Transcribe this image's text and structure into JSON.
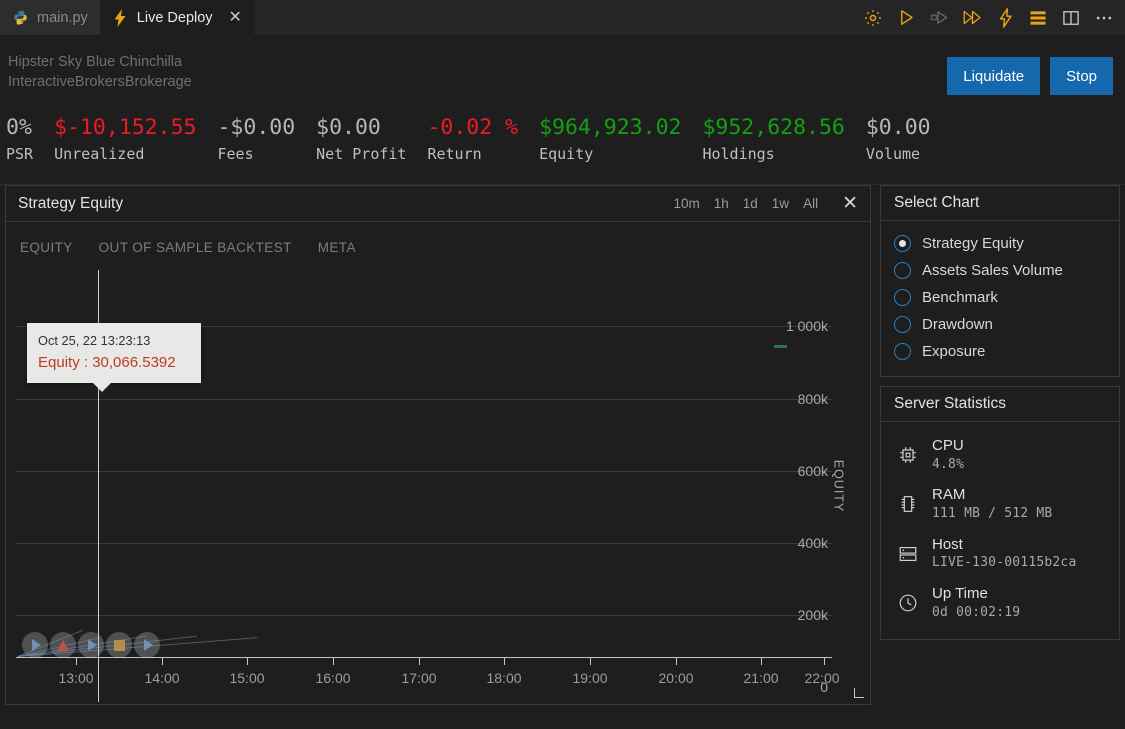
{
  "tabs": [
    {
      "label": "main.py",
      "icon": "python-icon",
      "active": false,
      "closable": false
    },
    {
      "label": "Live Deploy",
      "icon": "lightning-icon",
      "active": true,
      "closable": true,
      "close_glyph": "✕"
    }
  ],
  "toolbar_icons": [
    {
      "name": "gear-icon"
    },
    {
      "name": "play-icon"
    },
    {
      "name": "debug-play-icon"
    },
    {
      "name": "fast-forward-icon"
    },
    {
      "name": "lightning-icon"
    },
    {
      "name": "list-lines-icon"
    },
    {
      "name": "split-panel-icon"
    },
    {
      "name": "more-ellipsis-icon"
    }
  ],
  "header": {
    "project_name": "Hipster Sky Blue Chinchilla",
    "brokerage": "InteractiveBrokersBrokerage",
    "liquidate_label": "Liquidate",
    "stop_label": "Stop",
    "button_color": "#1668ad"
  },
  "stats": [
    {
      "value": "0%",
      "label": "PSR",
      "color": "grey"
    },
    {
      "value": "$-10,152.55",
      "label": "Unrealized",
      "color": "red"
    },
    {
      "value": "-$0.00",
      "label": "Fees",
      "color": "grey"
    },
    {
      "value": "$0.00",
      "label": "Net Profit",
      "color": "grey"
    },
    {
      "value": "-0.02 %",
      "label": "Return",
      "color": "red"
    },
    {
      "value": "$964,923.02",
      "label": "Equity",
      "color": "green"
    },
    {
      "value": "$952,628.56",
      "label": "Holdings",
      "color": "green"
    },
    {
      "value": "$0.00",
      "label": "Volume",
      "color": "grey"
    }
  ],
  "stat_colors": {
    "red": "#ec1c24",
    "green": "#13a113",
    "grey": "#b6b6b6"
  },
  "chart_panel": {
    "title": "Strategy Equity",
    "ranges": [
      "10m",
      "1h",
      "1d",
      "1w",
      "All"
    ],
    "close_glyph": "✕",
    "tabs": [
      "EQUITY",
      "OUT OF SAMPLE BACKTEST",
      "META"
    ],
    "tooltip": {
      "timestamp": "Oct 25, 22 13:23:13",
      "series_value": "Equity : 30,066.5392"
    }
  },
  "chart_data": {
    "type": "line",
    "title": "Strategy Equity",
    "xlabel": "",
    "ylabel": "EQUITY",
    "ylim": [
      0,
      1000000
    ],
    "yticks": [
      0,
      200000,
      400000,
      600000,
      800000,
      1000000
    ],
    "ytick_labels": [
      "0",
      "200k",
      "400k",
      "600k",
      "800k",
      "1 000k"
    ],
    "xticks": [
      "13:00",
      "14:00",
      "15:00",
      "16:00",
      "17:00",
      "18:00",
      "19:00",
      "20:00",
      "21:00",
      "22:00"
    ],
    "grid": true,
    "legend": "none",
    "series": [
      {
        "name": "Equity",
        "color": "#2e6e62",
        "x": [
          "13:23:13",
          "22:00"
        ],
        "values": [
          30066.5392,
          964923.02
        ]
      }
    ],
    "annotations": [
      {
        "type": "crosshair",
        "x": "13:23:13"
      },
      {
        "type": "tooltip",
        "x": "Oct 25, 22 13:23:13",
        "text": "Equity : 30,066.5392",
        "value": 30066.5392
      }
    ],
    "markers": [
      {
        "icon": "play-marker",
        "glyph": "play"
      },
      {
        "icon": "warning-marker",
        "glyph": "warning"
      },
      {
        "icon": "play-marker",
        "glyph": "play"
      },
      {
        "icon": "stop-marker",
        "glyph": "stop"
      },
      {
        "icon": "play-marker",
        "glyph": "play"
      }
    ]
  },
  "select_chart": {
    "title": "Select Chart",
    "options": [
      {
        "label": "Strategy Equity",
        "selected": true
      },
      {
        "label": "Assets Sales Volume",
        "selected": false
      },
      {
        "label": "Benchmark",
        "selected": false
      },
      {
        "label": "Drawdown",
        "selected": false
      },
      {
        "label": "Exposure",
        "selected": false
      }
    ],
    "accent": "#2a7fbf"
  },
  "server_statistics": {
    "title": "Server Statistics",
    "rows": [
      {
        "icon": "cpu-icon",
        "label": "CPU",
        "value": "4.8%"
      },
      {
        "icon": "ram-icon",
        "label": "RAM",
        "value": "111 MB / 512 MB"
      },
      {
        "icon": "server-icon",
        "label": "Host",
        "value": "LIVE-130-00115b2ca"
      },
      {
        "icon": "clock-icon",
        "label": "Up Time",
        "value": "0d 00:02:19"
      }
    ]
  }
}
